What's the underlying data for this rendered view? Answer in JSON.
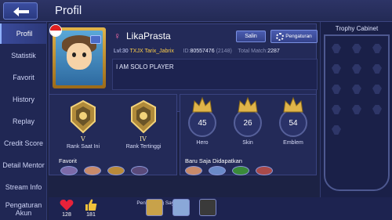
{
  "header": {
    "title": "Profil"
  },
  "sidebar": {
    "items": [
      {
        "label": "Profil",
        "active": true
      },
      {
        "label": "Statistik"
      },
      {
        "label": "Favorit"
      },
      {
        "label": "History"
      },
      {
        "label": "Replay"
      },
      {
        "label": "Credit Score"
      },
      {
        "label": "Detail Mentor"
      },
      {
        "label": "Stream Info"
      },
      {
        "label": "Pengaturan Akun"
      }
    ]
  },
  "profile": {
    "name": "LikaPrasta",
    "gender_symbol": "♀",
    "level_label": "Lvl:30",
    "squad": "TXJX",
    "squad_member": "Tarix_Jabrix",
    "id_label": "ID:",
    "id_value": "80557476",
    "server": "(2148)",
    "total_match_label": "Total Match:",
    "total_match_value": "2287",
    "bio": "I AM SOLO PLAYER",
    "copy_button": "Salin",
    "settings_button": "Pengaturan"
  },
  "ranks": {
    "current": {
      "roman": "V",
      "label": "Rank Saat Ini"
    },
    "highest": {
      "roman": "IV",
      "label": "Rank Tertinggi"
    }
  },
  "stats": [
    {
      "label": "Hero",
      "value": "45"
    },
    {
      "label": "Skin",
      "value": "26"
    },
    {
      "label": "Emblem",
      "value": "54"
    }
  ],
  "favorites": {
    "title": "Favorit"
  },
  "recent": {
    "title": "Baru Saja Didapatkan"
  },
  "trophy": {
    "title": "Trophy Cabinet"
  },
  "bottom": {
    "likes": "128",
    "thumbs": "181",
    "visitors_label": "Pengunjung Saya"
  },
  "colors": {
    "background": "#1c2244",
    "panel": "#232a58",
    "accent_gold": "#ffcf4a",
    "gender_pink": "#ff6fa8"
  }
}
